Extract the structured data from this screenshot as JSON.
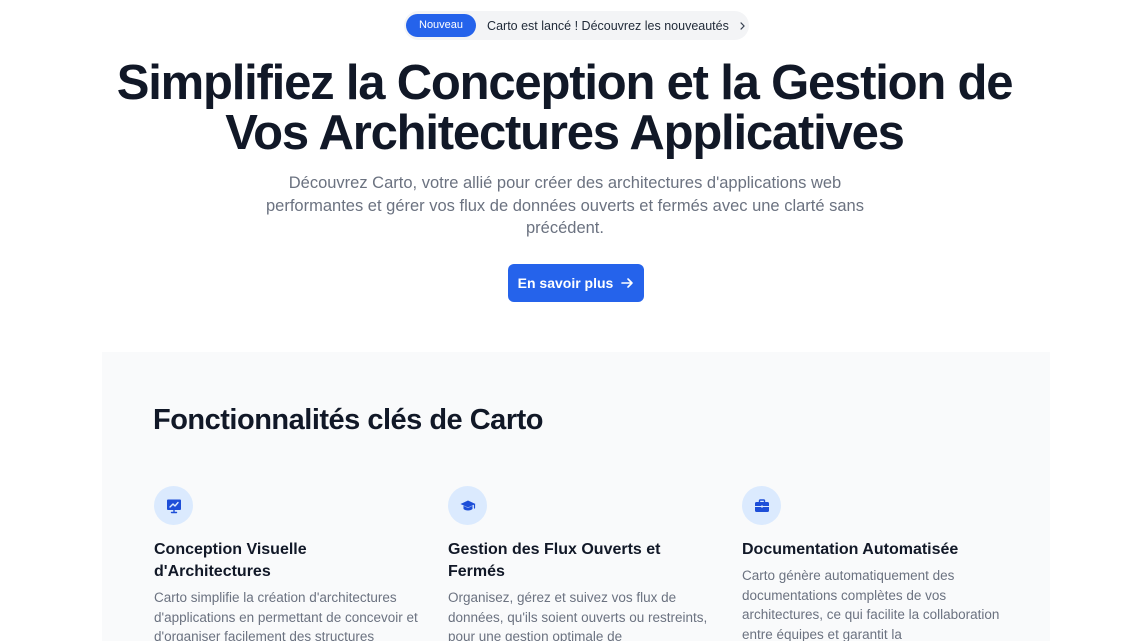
{
  "announcement": {
    "badge": "Nouveau",
    "text": "Carto est lancé ! Découvrez les nouveautés",
    "icon": "chevron-right-icon"
  },
  "hero": {
    "title_line1": "Simplifiez la Conception et la Gestion de",
    "title_line2": "Vos Architectures Applicatives",
    "subtitle": "Découvrez Carto, votre allié pour créer des architectures d'applications web performantes et gérer vos flux de données ouverts et fermés avec une clarté sans précédent.",
    "cta_label": "En savoir plus",
    "cta_icon": "arrow-right-icon"
  },
  "features": {
    "title": "Fonctionnalités clés de Carto",
    "items": [
      {
        "icon": "presentation-chart-icon",
        "title": "Conception Visuelle d'Architectures",
        "description": "Carto simplifie la création d'architectures d'applications en permettant de concevoir et d'organiser facilement des structures"
      },
      {
        "icon": "graduation-cap-icon",
        "title": "Gestion des Flux Ouverts et Fermés",
        "description": "Organisez, gérez et suivez vos flux de données, qu'ils soient ouverts ou restreints, pour une gestion optimale de"
      },
      {
        "icon": "briefcase-icon",
        "title": "Documentation Automatisée",
        "description": "Carto génère automatiquement des documentations complètes de vos architectures, ce qui facilite la collaboration entre équipes et garantit la"
      }
    ]
  },
  "colors": {
    "accent": "#2563eb",
    "icon_bg": "#dbeafe",
    "text_dark": "#111827",
    "text_muted": "#6b7280",
    "section_bg": "#f9fafb"
  }
}
